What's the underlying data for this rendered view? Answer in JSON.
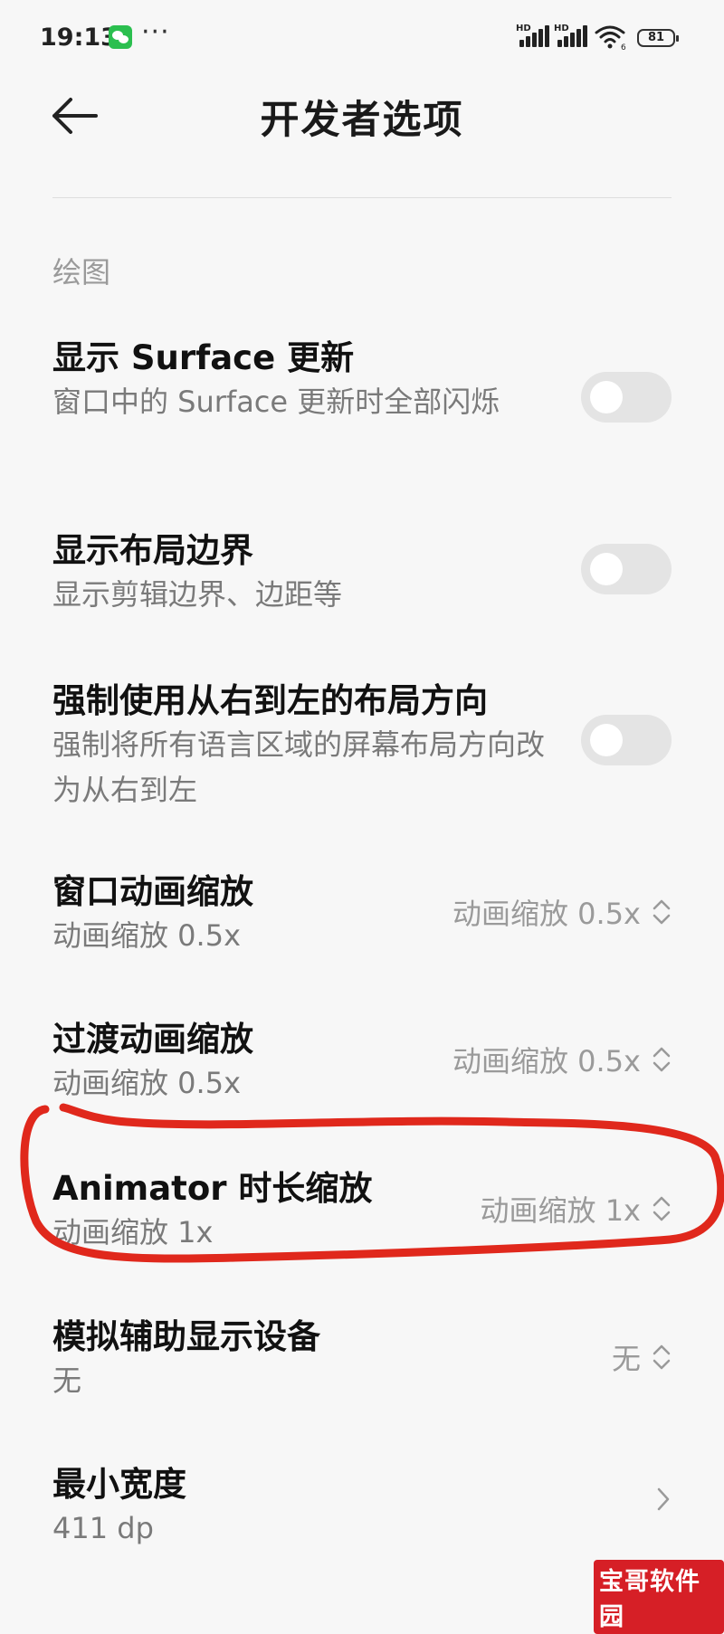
{
  "status": {
    "time": "19:13",
    "hd1": "HD",
    "hd2": "HD",
    "wifi_badge": "6",
    "battery": "81"
  },
  "header": {
    "title": "开发者选项"
  },
  "section": {
    "label": "绘图"
  },
  "items": [
    {
      "title": "显示 Surface 更新",
      "subtitle": "窗口中的 Surface 更新时全部闪烁"
    },
    {
      "title": "显示布局边界",
      "subtitle": "显示剪辑边界、边距等"
    },
    {
      "title": "强制使用从右到左的布局方向",
      "subtitle": "强制将所有语言区域的屏幕布局方向改为从右到左"
    },
    {
      "title": "窗口动画缩放",
      "subtitle": "动画缩放 0.5x",
      "value": "动画缩放 0.5x"
    },
    {
      "title": "过渡动画缩放",
      "subtitle": "动画缩放 0.5x",
      "value": "动画缩放 0.5x"
    },
    {
      "title": "Animator 时长缩放",
      "subtitle": "动画缩放 1x",
      "value": "动画缩放 1x"
    },
    {
      "title": "模拟辅助显示设备",
      "subtitle": "无",
      "value": "无"
    },
    {
      "title": "最小宽度",
      "subtitle": "411 dp"
    }
  ],
  "toggles": [
    false,
    false,
    false
  ],
  "watermark": "宝哥软件园",
  "colors": {
    "annotation": "#e0281c",
    "toggle_off": "#e4e4e4",
    "background": "#f7f7f7"
  }
}
